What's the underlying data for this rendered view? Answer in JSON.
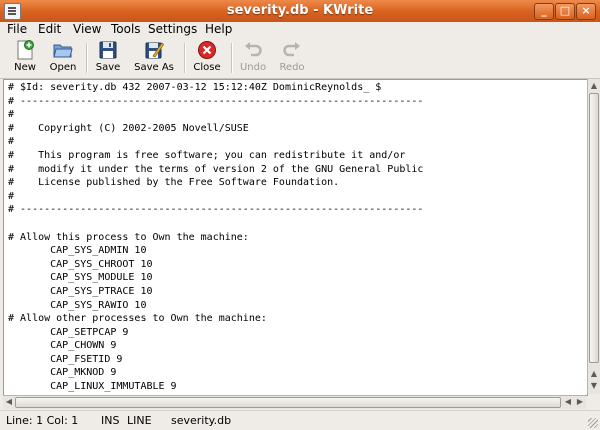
{
  "window": {
    "title": "severity.db - KWrite",
    "controls": [
      "_",
      "□",
      "×"
    ]
  },
  "menubar": {
    "items": [
      "File",
      "Edit",
      "View",
      "Tools",
      "Settings",
      "Help"
    ]
  },
  "toolbar": {
    "buttons": [
      {
        "label": "New",
        "icon": "new-document-icon",
        "enabled": true
      },
      {
        "label": "Open",
        "icon": "open-folder-icon",
        "enabled": true
      },
      {
        "label": "Save",
        "icon": "floppy-disk-icon",
        "enabled": true
      },
      {
        "label": "Save As",
        "icon": "save-as-icon",
        "enabled": true
      },
      {
        "label": "Close",
        "icon": "close-circle-icon",
        "enabled": true
      },
      {
        "label": "Undo",
        "icon": "undo-icon",
        "enabled": false
      },
      {
        "label": "Redo",
        "icon": "redo-icon",
        "enabled": false
      }
    ]
  },
  "editor": {
    "lines": [
      "# $Id: severity.db 432 2007-03-12 15:12:40Z DominicReynolds_ $",
      "# -------------------------------------------------------------------",
      "#",
      "#    Copyright (C) 2002-2005 Novell/SUSE",
      "#",
      "#    This program is free software; you can redistribute it and/or",
      "#    modify it under the terms of version 2 of the GNU General Public",
      "#    License published by the Free Software Foundation.",
      "#",
      "# -------------------------------------------------------------------",
      "",
      "# Allow this process to Own the machine:",
      "       CAP_SYS_ADMIN 10",
      "       CAP_SYS_CHROOT 10",
      "       CAP_SYS_MODULE 10",
      "       CAP_SYS_PTRACE 10",
      "       CAP_SYS_RAWIO 10",
      "# Allow other processes to Own the machine:",
      "       CAP_SETPCAP 9",
      "       CAP_CHOWN 9",
      "       CAP_FSETID 9",
      "       CAP_MKNOD 9",
      "       CAP_LINUX_IMMUTABLE 9"
    ]
  },
  "statusbar": {
    "position": "Line: 1 Col: 1",
    "mode": "INS",
    "selection": "LINE",
    "filename": "severity.db"
  },
  "colors": {
    "titlebar": "#d96420",
    "editor_bg": "#ffffff",
    "chrome": "#efebe7"
  }
}
